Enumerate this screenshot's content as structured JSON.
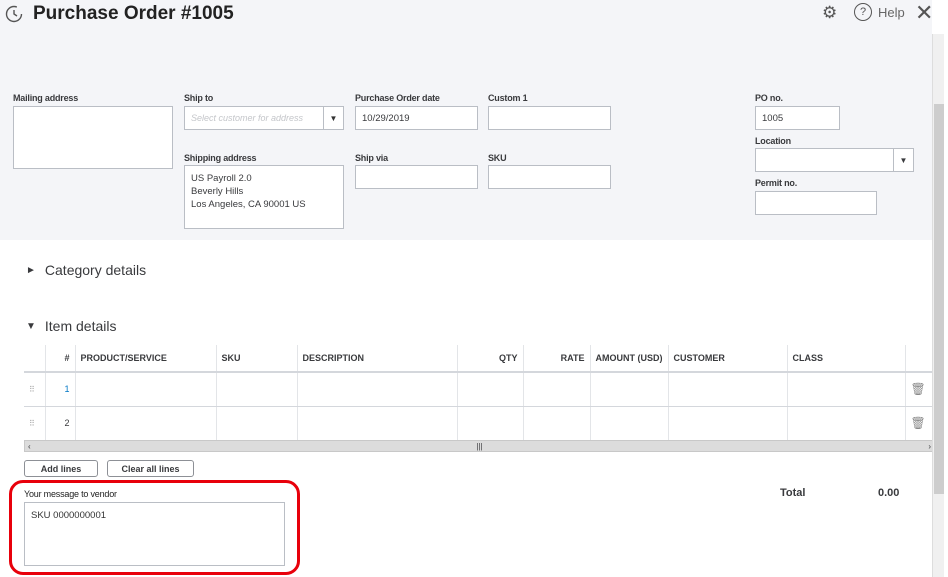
{
  "header": {
    "title": "Purchase Order #1005",
    "help": "Help"
  },
  "form": {
    "mailing_address_label": "Mailing address",
    "ship_to_label": "Ship to",
    "ship_to_placeholder": "Select customer for address",
    "po_date_label": "Purchase Order date",
    "po_date": "10/29/2019",
    "custom1_label": "Custom 1",
    "shipping_address_label": "Shipping address",
    "shipping_address": "US Payroll 2.0\nBeverly Hills\nLos Angeles, CA  90001 US",
    "ship_via_label": "Ship via",
    "sku_label": "SKU",
    "po_no_label": "PO no.",
    "po_no": "1005",
    "location_label": "Location",
    "permit_label": "Permit no."
  },
  "sections": {
    "category": "Category details",
    "item": "Item details"
  },
  "table": {
    "columns": [
      "#",
      "PRODUCT/SERVICE",
      "SKU",
      "DESCRIPTION",
      "QTY",
      "RATE",
      "AMOUNT (USD)",
      "CUSTOMER",
      "CLASS"
    ],
    "rows": [
      {
        "n": "1"
      },
      {
        "n": "2"
      }
    ]
  },
  "buttons": {
    "add_lines": "Add lines",
    "clear_lines": "Clear all lines"
  },
  "message": {
    "label": "Your message to vendor",
    "value": "SKU 0000000001"
  },
  "total": {
    "label": "Total",
    "value": "0.00"
  },
  "colors": {
    "highlight": "#e8000b"
  }
}
